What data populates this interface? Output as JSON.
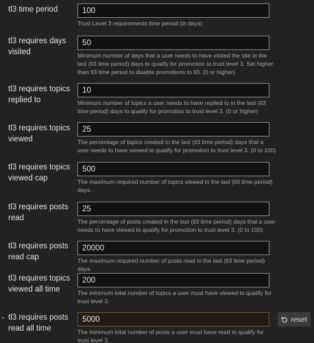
{
  "settings": [
    {
      "label": "tl3 time period",
      "value": "100",
      "description": "Trust Level 3 requirements time period (in days)"
    },
    {
      "label": "tl3 requires days visited",
      "value": "50",
      "description": "Minimum number of days that a user needs to have visited the site in the last (tl3 time period) days to qualify for promotion to trust level 3. Set higher than tl3 time period to disable promotions to tl3. (0 or higher)"
    },
    {
      "label": "tl3 requires topics replied to",
      "value": "10",
      "description": "Minimum number of topics a user needs to have replied to in the last (tl3 time period) days to qualify for promotion to trust level 3. (0 or higher)"
    },
    {
      "label": "tl3 requires topics viewed",
      "value": "25",
      "description": "The percentage of topics created in the last (tl3 time period) days that a user needs to have viewed to qualify for promotion to trust level 3. (0 to 100)"
    },
    {
      "label": "tl3 requires topics viewed cap",
      "value": "500",
      "description": "The maximum required number of topics viewed in the last (tl3 time period) days."
    },
    {
      "label": "tl3 requires posts read",
      "value": "25",
      "description": "The percentage of posts created in the last (tl3 time period) days that a user needs to have viewed to qualify for promotion to trust level 3. (0 to 100)"
    },
    {
      "label": "tl3 requires posts read cap",
      "value": "20000",
      "description": "The maximum required number of posts read in the last (tl3 time period) days."
    },
    {
      "label": "tl3 requires topics viewed all time",
      "value": "200",
      "description": "The minimum total number of topics a user must have viewed to qualify for trust level 3."
    },
    {
      "label": "tl3 requires posts read all time",
      "value": "5000",
      "description": "The minimum total number of posts a user must have read to qualify for trust level 3.",
      "overridden": true,
      "reset_label": "reset",
      "reset_icon": "undo-icon"
    }
  ],
  "colors": {
    "background": "#222222",
    "input_background": "#111111",
    "overridden_input_background": "#231c14",
    "description_text": "#a9a9a9",
    "reset_button": "#3a3a3a"
  }
}
